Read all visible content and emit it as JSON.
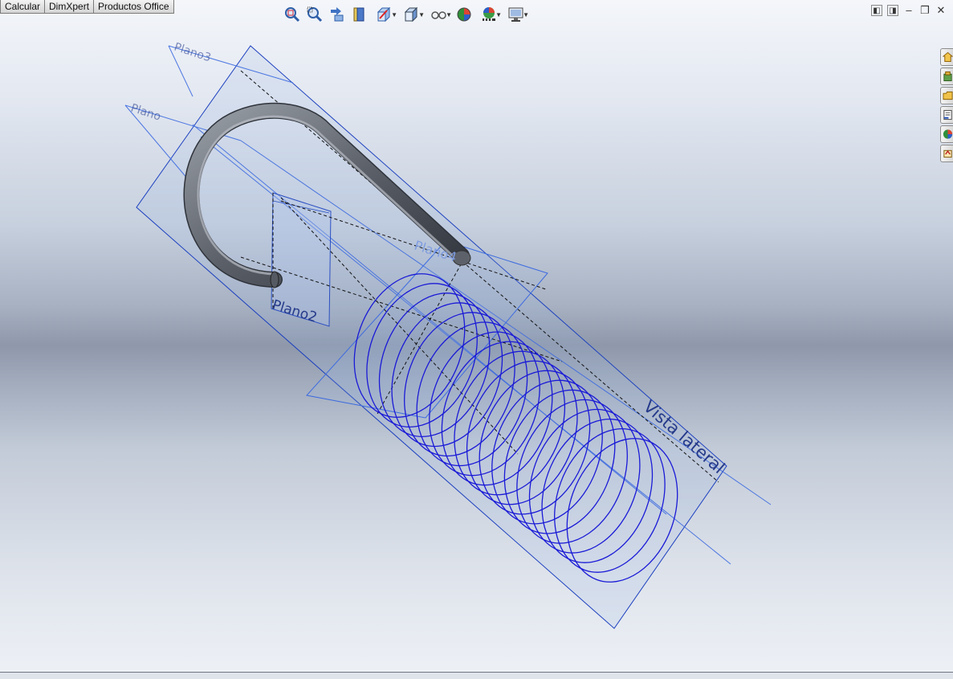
{
  "command_tabs": [
    "Calcular",
    "DimXpert",
    "Productos Office"
  ],
  "heads_up_toolbar": [
    {
      "icon": "zoom-to-fit-icon",
      "dropdown": false
    },
    {
      "icon": "zoom-to-area-icon",
      "dropdown": false
    },
    {
      "icon": "previous-view-icon",
      "dropdown": false
    },
    {
      "icon": "section-view-icon",
      "dropdown": false
    },
    {
      "icon": "view-orientation-icon",
      "dropdown": true
    },
    {
      "icon": "display-style-icon",
      "dropdown": true
    },
    {
      "icon": "hide-show-items-icon",
      "dropdown": true
    },
    {
      "icon": "edit-appearance-icon",
      "dropdown": false
    },
    {
      "icon": "apply-scene-icon",
      "dropdown": true
    },
    {
      "icon": "view-settings-icon",
      "dropdown": true
    }
  ],
  "window_controls": [
    "tile-horizontal-icon",
    "tile-vertical-icon",
    "minimize-icon",
    "restore-icon",
    "close-icon"
  ],
  "task_pane_tabs": [
    "solidworks-resources-icon",
    "design-library-icon",
    "file-explorer-icon",
    "view-palette-icon",
    "appearances-scenes-icon",
    "custom-properties-icon"
  ],
  "scene": {
    "plane_labels": {
      "plano_top_1": "Plano3",
      "plano_top_2": "Plano",
      "plano2": "Plano2",
      "plano4": "Plano4",
      "vista_lateral": "Vista lateral"
    },
    "colors": {
      "plane_edge": "#1b3fbf",
      "plane_fill": "#9bb6e6",
      "helix": "#1a1ad6",
      "pipe": "#6c7079",
      "label": "#253a8a"
    }
  }
}
